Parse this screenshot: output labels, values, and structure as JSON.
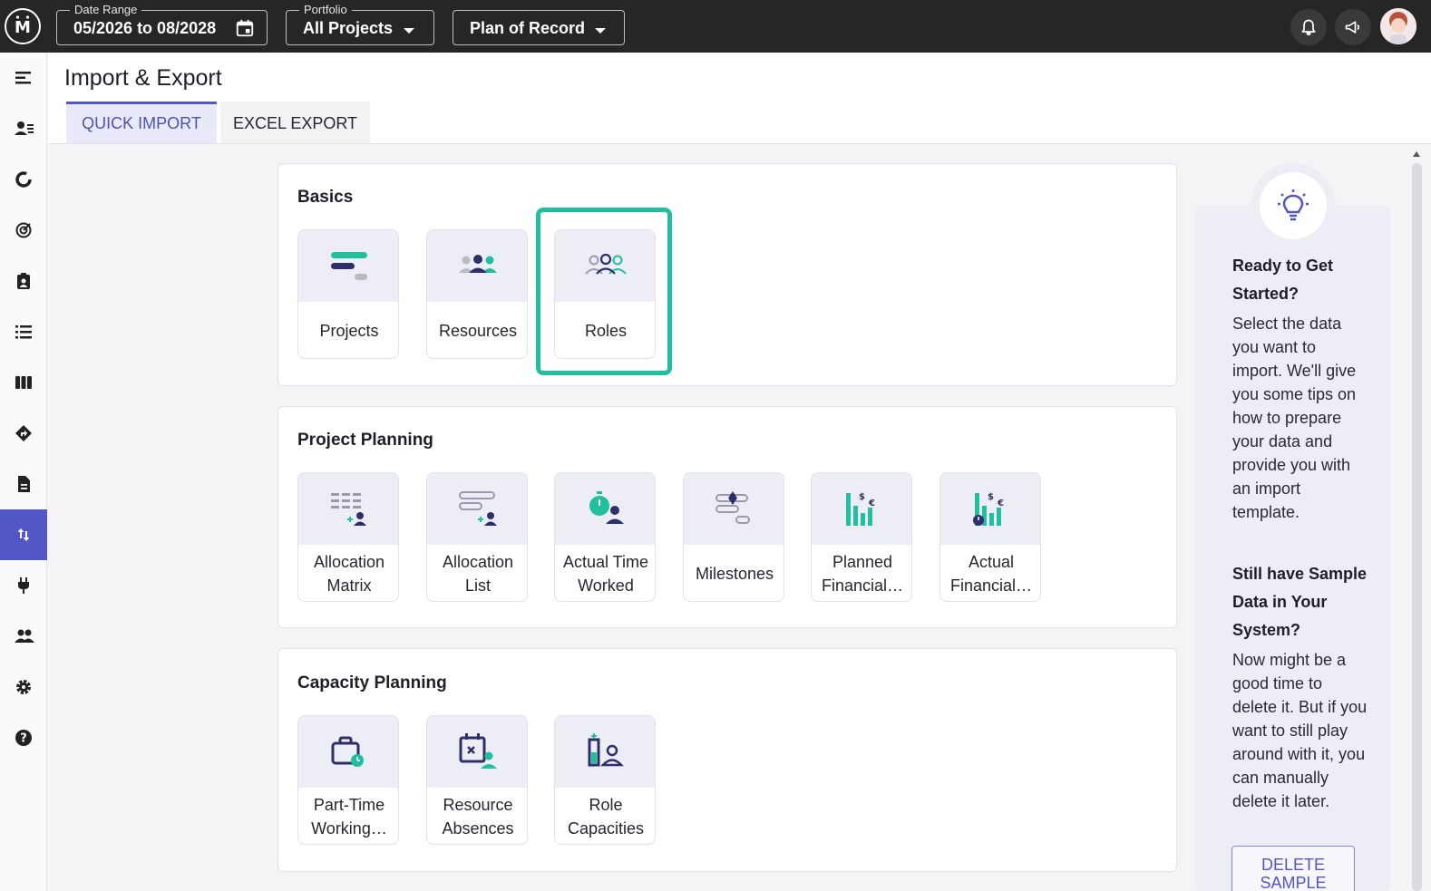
{
  "topbar": {
    "date_range": {
      "legend": "Date Range",
      "value": "05/2026 to 08/2028"
    },
    "portfolio": {
      "legend": "Portfolio",
      "value": "All Projects"
    },
    "plan": {
      "value": "Plan of Record"
    }
  },
  "header": {
    "title": "Import & Export",
    "tabs": [
      {
        "label": "QUICK IMPORT",
        "active": true
      },
      {
        "label": "EXCEL EXPORT",
        "active": false
      }
    ]
  },
  "sections": {
    "basics": {
      "title": "Basics",
      "tiles": [
        "Projects",
        "Resources",
        "Roles"
      ]
    },
    "project_planning": {
      "title": "Project Planning",
      "tiles": [
        "Allocation\nMatrix",
        "Allocation\nList",
        "Actual Time\nWorked",
        "Milestones",
        "Planned\nFinancial…",
        "Actual\nFinancial…"
      ]
    },
    "capacity_planning": {
      "title": "Capacity Planning",
      "tiles": [
        "Part-Time\nWorking…",
        "Resource\nAbsences",
        "Role\nCapacities"
      ]
    }
  },
  "tips": {
    "heading1": "Ready to Get Started?",
    "text1": "Select the data you want to import. We'll give you some tips on how to prepare your data and provide you with an import template.",
    "heading2": "Still have Sample Data in Your System?",
    "text2": "Now might be a good time to delete it. But if you want to still play around with it, you can manually delete it later.",
    "delete_button": "DELETE SAMPLE"
  },
  "colors": {
    "accent": "#5356c7",
    "teal": "#1fbf9f",
    "navy": "#2d2f6b",
    "topbar": "#262626"
  }
}
